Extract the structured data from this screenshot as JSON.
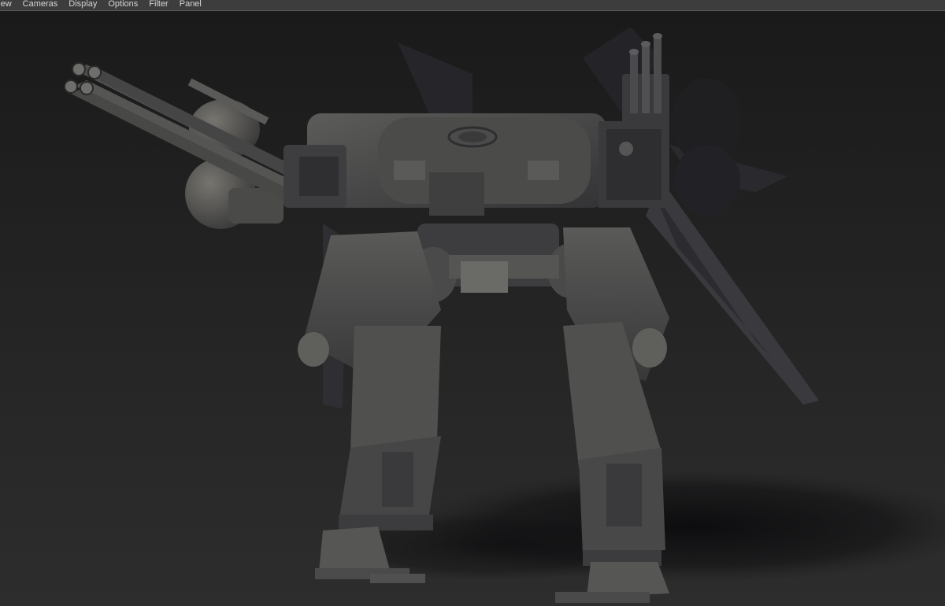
{
  "menubar": {
    "items": [
      "View",
      "Cameras",
      "Display",
      "Options",
      "Filter",
      "Panel"
    ]
  },
  "viewport": {
    "content": "mech-robot-3d-model",
    "colors": {
      "background_top": "#1b1b1b",
      "background_bottom": "#2c2c2c",
      "model_base": "#4d4d4d",
      "model_light": "#6a6a66",
      "model_dark": "#2e2e30",
      "ground_shadow": "#0e0e10"
    }
  }
}
